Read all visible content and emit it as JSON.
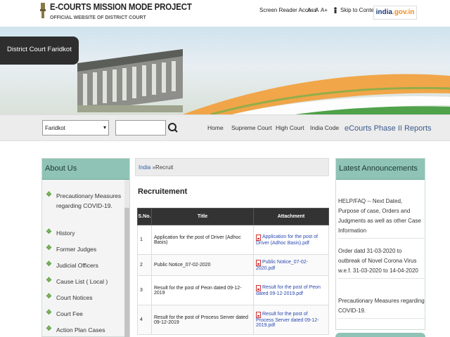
{
  "header": {
    "title": "E-COURTS MISSION MODE PROJECT",
    "subtitle": "OFFICIAL WEBSITE OF DISTRICT COURT",
    "screen_reader": "Screen Reader Access",
    "font_small": "A-",
    "font_normal": "A",
    "font_large": "A+",
    "skip": "Skip to Content",
    "india_logo_a": "india",
    "india_logo_b": ".gov.in"
  },
  "banner": {
    "court_label": "District Court Faridkot"
  },
  "nav": {
    "district_selected": "Faridkot",
    "links": [
      "Home",
      "Supreme Court",
      "High Court",
      "India Code",
      "eCourts Phase II Reports"
    ]
  },
  "sidebar": {
    "title": "About Us",
    "items": [
      "Precautionary Measures regarding COVID-19.",
      "History",
      "Former Judges",
      "Judicial Officers",
      "Cause List ( Local )",
      "Court Notices",
      "Court Fee",
      "Action Plan Cases"
    ]
  },
  "main": {
    "breadcrumb_home": "India",
    "breadcrumb_sep": "»",
    "breadcrumb_current": "Recruit",
    "title": "Recruitement",
    "columns": [
      "S.No.",
      "Title",
      "Attachment"
    ],
    "rows": [
      {
        "sno": "1",
        "title": "Application for the post of Driver (Adhoc Basis)",
        "attachment": "Application for the post of Driver (Adhoc Basis).pdf"
      },
      {
        "sno": "2",
        "title": "Public Notice_07-02-2020",
        "attachment": "Public Notice_07-02-2020.pdf"
      },
      {
        "sno": "3",
        "title": "Result for the post of Peon dated 09-12-2019",
        "attachment": "Result for the post of Peon dated 09-12-2019.pdf"
      },
      {
        "sno": "4",
        "title": "Result for the post of Process Server dated 09-12-2019",
        "attachment": "Result for the post of Process Server dated 09-12-2019.pdf"
      }
    ]
  },
  "announcements": {
    "title": "Latest Announcements",
    "items": [
      "HELP/FAQ -- Next Dated, Purpose of case, Orders and Judgments as well as other Case Information",
      "Order datd 31-03-2020 to outbreak of Novel Corona Virus w.e.f. 31-03-2020 to 14-04-2020",
      "Precautionary Measures regarding COVID-19."
    ]
  },
  "colors": {
    "panel_header": "#8fc3b6",
    "nav_bg": "#ececec",
    "table_header": "#333333",
    "link": "#2a47b0"
  }
}
